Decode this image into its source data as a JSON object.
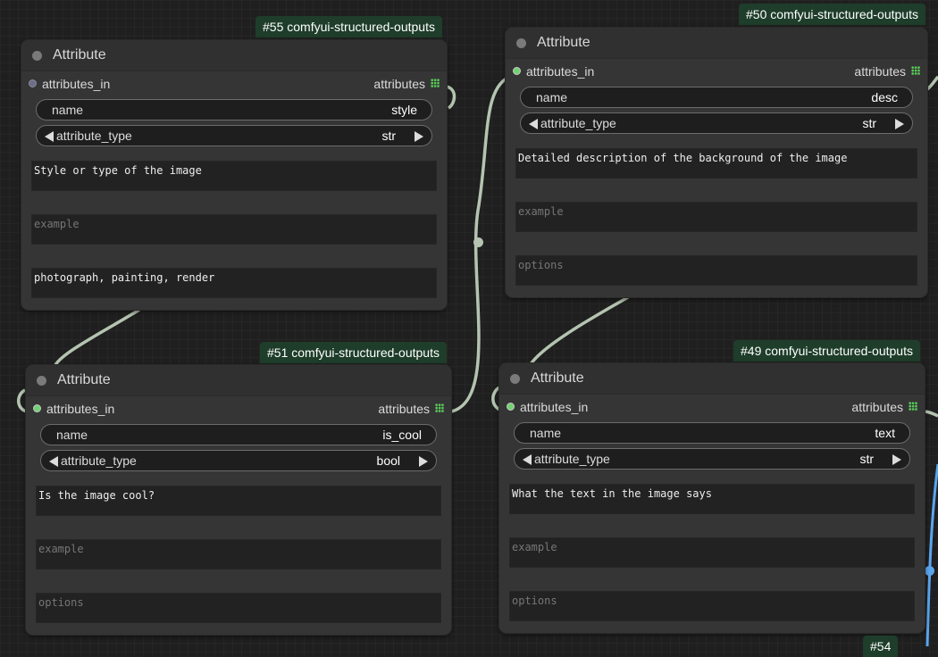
{
  "colors": {
    "link_green": "#b4c4b0",
    "link_blue": "#5aa6ee",
    "badge_bg": "#1e3d2a",
    "slot_active": "#6fd36f"
  },
  "nodes": [
    {
      "badge": "#55 comfyui-structured-outputs",
      "title": "Attribute",
      "input_label": "attributes_in",
      "output_label": "attributes",
      "name_label": "name",
      "name_value": "style",
      "type_label": "attribute_type",
      "type_value": "str",
      "description": "Style or type of the image",
      "example_placeholder": "example",
      "options_value": "photograph, painting, render",
      "options_placeholder": ""
    },
    {
      "badge": "#50 comfyui-structured-outputs",
      "title": "Attribute",
      "input_label": "attributes_in",
      "output_label": "attributes",
      "name_label": "name",
      "name_value": "desc",
      "type_label": "attribute_type",
      "type_value": "str",
      "description": "Detailed description of the background of the image",
      "example_placeholder": "example",
      "options_value": "",
      "options_placeholder": "options"
    },
    {
      "badge": "#51 comfyui-structured-outputs",
      "title": "Attribute",
      "input_label": "attributes_in",
      "output_label": "attributes",
      "name_label": "name",
      "name_value": "is_cool",
      "type_label": "attribute_type",
      "type_value": "bool",
      "description": "Is the image cool?",
      "example_placeholder": "example",
      "options_value": "",
      "options_placeholder": "options"
    },
    {
      "badge": "#49 comfyui-structured-outputs",
      "title": "Attribute",
      "input_label": "attributes_in",
      "output_label": "attributes",
      "name_label": "name",
      "name_value": "text",
      "type_label": "attribute_type",
      "type_value": "str",
      "description": "What the text in the image says",
      "example_placeholder": "example",
      "options_value": "",
      "options_placeholder": "options"
    }
  ],
  "partial_badge": "#54"
}
